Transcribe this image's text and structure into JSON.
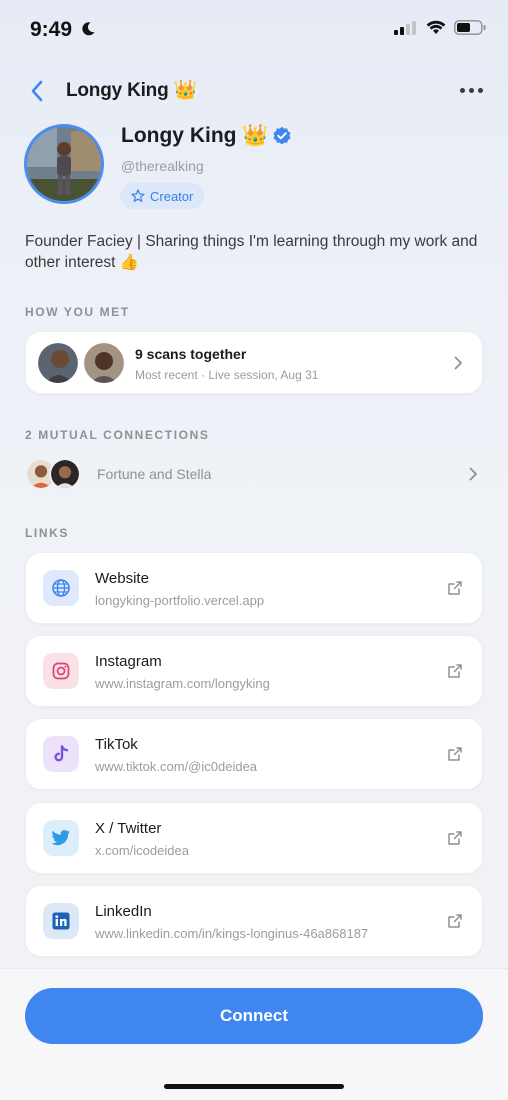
{
  "status_bar": {
    "time": "9:49"
  },
  "nav": {
    "title": "Longy King 👑"
  },
  "profile": {
    "name": "Longy King 👑",
    "handle": "@therealking",
    "badge": "Creator",
    "verified_color": "#3f86f0"
  },
  "bio": "Founder Faciey | Sharing things I'm learning through my work and other interest 👍",
  "how_you_met": {
    "label": "HOW YOU MET",
    "title": "9 scans together",
    "subtitle": "Most recent · Live session, Aug 31"
  },
  "mutual": {
    "label": "2 MUTUAL CONNECTIONS",
    "names": "Fortune and Stella"
  },
  "links": {
    "label": "LINKS",
    "items": [
      {
        "title": "Website",
        "url": "longyking-portfolio.vercel.app",
        "icon": "globe-icon"
      },
      {
        "title": "Instagram",
        "url": "www.instagram.com/longyking",
        "icon": "instagram-icon"
      },
      {
        "title": "TikTok",
        "url": "www.tiktok.com/@ic0deidea",
        "icon": "tiktok-icon"
      },
      {
        "title": "X / Twitter",
        "url": "x.com/icodeidea",
        "icon": "twitter-icon"
      },
      {
        "title": "LinkedIn",
        "url": "www.linkedin.com/in/kings-longinus-46a868187",
        "icon": "linkedin-icon"
      }
    ]
  },
  "cta": {
    "label": "Connect",
    "color": "#3f86f0"
  }
}
